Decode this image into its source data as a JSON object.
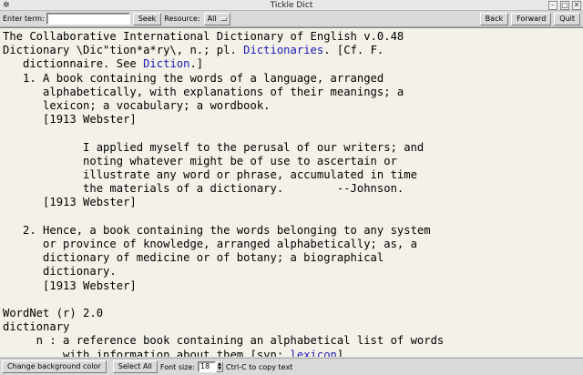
{
  "window": {
    "title": "Tickle Dict",
    "menu_glyph": "✲",
    "min_glyph": "–",
    "max_glyph": "▢",
    "close_glyph": "✕"
  },
  "toolbar": {
    "enter_term_label": "Enter term:",
    "term_value": "",
    "seek_label": "Seek",
    "resource_label": "Resource:",
    "resource_value": "All",
    "back_label": "Back",
    "forward_label": "Forward",
    "quit_label": "Quit"
  },
  "content": {
    "lines": [
      [
        {
          "t": "The Collaborative International Dictionary of English v.0.48"
        }
      ],
      [
        {
          "t": "Dictionary \\Dic\"tion*a*ry\\, n.; pl. "
        },
        {
          "t": "Dictionaries",
          "link": true
        },
        {
          "t": ". [Cf. F."
        }
      ],
      [
        {
          "t": "   dictionnaire. See "
        },
        {
          "t": "Diction",
          "link": true
        },
        {
          "t": ".]"
        }
      ],
      [
        {
          "t": "   1. A book containing the words of a language, arranged"
        }
      ],
      [
        {
          "t": "      alphabetically, with explanations of their meanings; a"
        }
      ],
      [
        {
          "t": "      lexicon; a vocabulary; a wordbook."
        }
      ],
      [
        {
          "t": "      [1913 Webster]"
        }
      ],
      [
        {
          "t": ""
        }
      ],
      [
        {
          "t": "            I applied myself to the perusal of our writers; and"
        }
      ],
      [
        {
          "t": "            noting whatever might be of use to ascertain or"
        }
      ],
      [
        {
          "t": "            illustrate any word or phrase, accumulated in time"
        }
      ],
      [
        {
          "t": "            the materials of a dictionary.        --Johnson."
        }
      ],
      [
        {
          "t": "      [1913 Webster]"
        }
      ],
      [
        {
          "t": ""
        }
      ],
      [
        {
          "t": "   2. Hence, a book containing the words belonging to any system"
        }
      ],
      [
        {
          "t": "      or province of knowledge, arranged alphabetically; as, a"
        }
      ],
      [
        {
          "t": "      dictionary of medicine or of botany; a biographical"
        }
      ],
      [
        {
          "t": "      dictionary."
        }
      ],
      [
        {
          "t": "      [1913 Webster]"
        }
      ],
      [
        {
          "t": ""
        }
      ],
      [
        {
          "t": "WordNet (r) 2.0"
        }
      ],
      [
        {
          "t": "dictionary"
        }
      ],
      [
        {
          "t": "     n : a reference book containing an alphabetical list of words"
        }
      ],
      [
        {
          "t": "         with information about them [syn: "
        },
        {
          "t": "lexicon",
          "link": true
        },
        {
          "t": "]"
        }
      ]
    ]
  },
  "statusbar": {
    "bg_color_label": "Change background color",
    "select_all_label": "Select All",
    "font_size_label": "Font size:",
    "font_size_value": "18",
    "hint_text": "Ctrl-C to copy text"
  },
  "colors": {
    "link": "#1a1ab4",
    "text_bg": "#f3f1e8",
    "chrome": "#d9d9d9"
  }
}
